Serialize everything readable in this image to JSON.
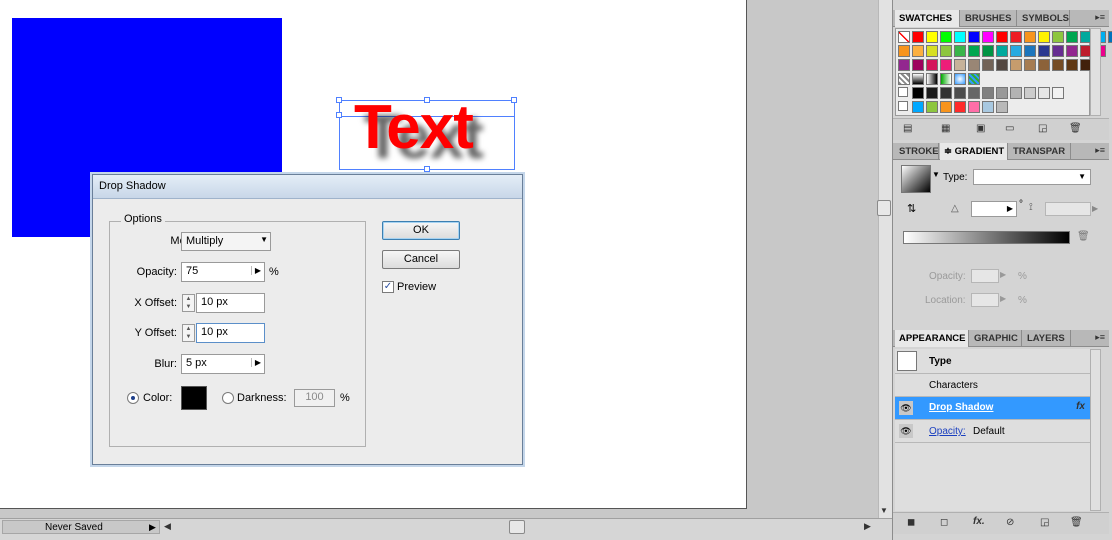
{
  "canvas": {
    "text_object": "Text",
    "colors": {
      "blue_rect": "#0000ff",
      "text_fill": "#ff0000",
      "selection": "#4f80ff"
    }
  },
  "status_bar": {
    "doc_status": "Never Saved"
  },
  "dialog": {
    "title": "Drop Shadow",
    "options_label": "Options",
    "mode_label": "Mode:",
    "mode_value": "Multiply",
    "opacity_label": "Opacity:",
    "opacity_value": "75",
    "opacity_unit": "%",
    "x_offset_label": "X Offset:",
    "x_offset_value": "10 px",
    "y_offset_label": "Y Offset:",
    "y_offset_value": "10 px",
    "blur_label": "Blur:",
    "blur_value": "5 px",
    "color_label": "Color:",
    "darkness_label": "Darkness:",
    "darkness_value": "100",
    "darkness_unit": "%",
    "ok_label": "OK",
    "cancel_label": "Cancel",
    "preview_label": "Preview",
    "preview_checked": true,
    "color_selected": true,
    "shadow_color": "#000000"
  },
  "swatches_panel": {
    "tabs": [
      "SWATCHES",
      "BRUSHES",
      "SYMBOLS"
    ],
    "row1": [
      "#ff0000",
      "#ffff00",
      "#00ff00",
      "#00ffff",
      "#0000ff",
      "#ff00ff",
      "#ff0000",
      "#ed1c24",
      "#f7941d",
      "#fff200",
      "#8dc63f",
      "#00a651",
      "#00a99d",
      "#00aeef",
      "#0072bc",
      "#2e3192",
      "#92278f",
      "#ec008c"
    ],
    "row2": [
      "#f7941d",
      "#fbb040",
      "#d7df23",
      "#8dc63f",
      "#39b54a",
      "#00a651",
      "#009444",
      "#00a99d",
      "#27aae1",
      "#1c75bc",
      "#2b3990",
      "#662d91",
      "#92278f",
      "#be1e2d",
      "#ec008c"
    ],
    "row3": [
      "#93278f",
      "#9e005d",
      "#d4145a",
      "#ed1e79",
      "#c7b299",
      "#998675",
      "#736357",
      "#534741",
      "#c69c6d",
      "#a67c52",
      "#8c6239",
      "#754c24",
      "#603813",
      "#42210b"
    ],
    "gray_row": [
      "#000000",
      "#1a1a1a",
      "#333333",
      "#4d4d4d",
      "#666666",
      "#808080",
      "#999999",
      "#b3b3b3",
      "#cccccc",
      "#e6e6e6",
      "#f2f2f2"
    ],
    "extra_row": [
      "#00a8ff",
      "#8dc63f",
      "#f7941d",
      "#ff2a2a",
      "#ff6ea8",
      "#a8c8e0",
      "#b8b8b8"
    ]
  },
  "stroke_panel": {
    "tabs": [
      "STROKE",
      "GRADIENT",
      "TRANSPAR"
    ],
    "type_label": "Type:",
    "opacity_label": "Opacity:",
    "opacity_unit": "%",
    "location_label": "Location:",
    "location_unit": "%",
    "degree_unit": "°"
  },
  "appearance_panel": {
    "tabs": [
      "APPEARANCE",
      "GRAPHIC",
      "LAYERS"
    ],
    "object_type": "Type",
    "characters_label": "Characters",
    "effect_label": "Drop Shadow",
    "fx_label": "fx",
    "opacity_link": "Opacity:",
    "opacity_value": "Default",
    "selected_color": "#3399ff"
  }
}
